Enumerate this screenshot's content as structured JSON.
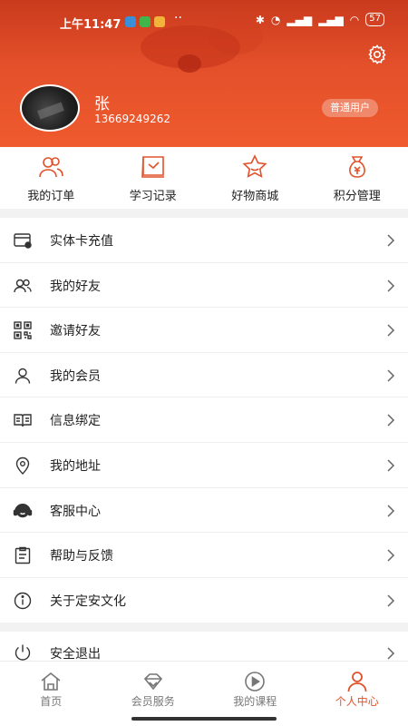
{
  "status_bar": {
    "time": "上午11:47",
    "battery": "57"
  },
  "profile": {
    "name": "张",
    "phone": "13669249262",
    "badge": "普通用户"
  },
  "quick_actions": [
    {
      "label": "我的订单",
      "icon": "people-icon"
    },
    {
      "label": "学习记录",
      "icon": "learning-record-icon"
    },
    {
      "label": "好物商城",
      "icon": "star-icon"
    },
    {
      "label": "积分管理",
      "icon": "money-bag-icon"
    }
  ],
  "menu": [
    {
      "label": "实体卡充值",
      "icon": "card-icon"
    },
    {
      "label": "我的好友",
      "icon": "friends-icon"
    },
    {
      "label": "邀请好友",
      "icon": "qrcode-icon"
    },
    {
      "label": "我的会员",
      "icon": "user-icon"
    },
    {
      "label": "信息绑定",
      "icon": "book-icon"
    },
    {
      "label": "我的地址",
      "icon": "location-icon"
    },
    {
      "label": "客服中心",
      "icon": "headset-icon"
    },
    {
      "label": "帮助与反馈",
      "icon": "clipboard-icon"
    },
    {
      "label": "关于定安文化",
      "icon": "info-icon"
    }
  ],
  "logout": {
    "label": "安全退出",
    "icon": "power-icon"
  },
  "bottom_nav": [
    {
      "label": "首页",
      "icon": "home-icon",
      "active": false
    },
    {
      "label": "会员服务",
      "icon": "diamond-icon",
      "active": false
    },
    {
      "label": "我的课程",
      "icon": "play-icon",
      "active": false
    },
    {
      "label": "个人中心",
      "icon": "person-icon",
      "active": true
    }
  ],
  "colors": {
    "accent": "#e0522b",
    "header_top": "#c93a1d",
    "header_bottom": "#ef5a2e"
  }
}
